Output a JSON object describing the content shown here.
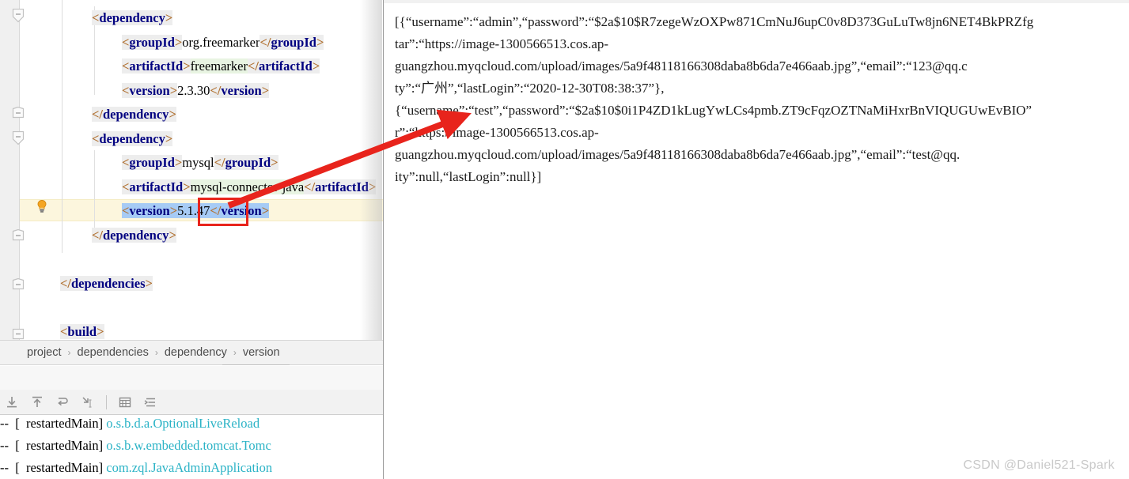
{
  "editor": {
    "lines": [
      {
        "indent": 0,
        "segments": [
          {
            "t": "tag",
            "v": "<dependency>"
          }
        ]
      },
      {
        "indent": 1,
        "segments": [
          {
            "t": "tag",
            "v": "<groupId>"
          },
          {
            "t": "txt",
            "v": "org.freemarker"
          },
          {
            "t": "tag",
            "v": "</groupId>"
          }
        ]
      },
      {
        "indent": 1,
        "segments": [
          {
            "t": "tag",
            "v": "<artifactId>"
          },
          {
            "t": "val",
            "v": "freemarker"
          },
          {
            "t": "tag",
            "v": "</artifactId>"
          }
        ]
      },
      {
        "indent": 1,
        "segments": [
          {
            "t": "tag",
            "v": "<version>"
          },
          {
            "t": "txt",
            "v": "2.3.30"
          },
          {
            "t": "tag",
            "v": "</version>"
          }
        ]
      },
      {
        "indent": 0,
        "segments": [
          {
            "t": "tag",
            "v": "</dependency>"
          }
        ]
      },
      {
        "indent": 0,
        "segments": [
          {
            "t": "tag",
            "v": "<dependency>"
          }
        ]
      },
      {
        "indent": 1,
        "segments": [
          {
            "t": "tag",
            "v": "<groupId>"
          },
          {
            "t": "txt",
            "v": "mysql"
          },
          {
            "t": "tag",
            "v": "</groupId>"
          }
        ]
      },
      {
        "indent": 1,
        "segments": [
          {
            "t": "tag",
            "v": "<artifactId>"
          },
          {
            "t": "val",
            "v": "mysql-connector-java"
          },
          {
            "t": "tag",
            "v": "</artifactId>"
          }
        ]
      },
      {
        "indent": 1,
        "segments": [
          {
            "t": "sel-tag",
            "v": "<version>"
          },
          {
            "t": "sel-txt",
            "v": "5.1.47"
          },
          {
            "t": "sel-tag",
            "v": "</version>"
          }
        ]
      },
      {
        "indent": 0,
        "segments": [
          {
            "t": "tag",
            "v": "</dependency>"
          }
        ]
      },
      {
        "indent": 0,
        "segments": []
      },
      {
        "indent": -1,
        "segments": [
          {
            "t": "tag",
            "v": "</dependencies>"
          }
        ]
      },
      {
        "indent": -1,
        "segments": []
      },
      {
        "indent": -1,
        "segments": [
          {
            "t": "tag",
            "v": "<build>"
          }
        ]
      }
    ],
    "highlighted_value": "5.1.47",
    "selected_line_text": "<version>5.1.47</version>",
    "language": "xml"
  },
  "breadcrumb": {
    "items": [
      "project",
      "dependencies",
      "dependency",
      "version"
    ],
    "separator": "›"
  },
  "console_toolbar": {
    "buttons": [
      {
        "name": "scroll-to-end",
        "glyph": "⤓"
      },
      {
        "name": "scroll-to-top",
        "glyph": "↑"
      },
      {
        "name": "soft-wrap",
        "glyph": "⤶"
      },
      {
        "name": "jump-to-source",
        "glyph": "⤷"
      },
      {
        "name": "print",
        "glyph": "▦"
      },
      {
        "name": "settings-lines",
        "glyph": "≡"
      }
    ]
  },
  "console": {
    "lines": [
      {
        "dash": "--",
        "bracket_open": "[",
        "thread": "restartedMain]",
        "cls": "o.s.b.d.a.OptionalLiveReload"
      },
      {
        "dash": "--",
        "bracket_open": "[",
        "thread": "restartedMain]",
        "cls": "o.s.b.w.embedded.tomcat.Tomc"
      },
      {
        "dash": "--",
        "bracket_open": "[",
        "thread": "restartedMain]",
        "cls": "com.zql.JavaAdminApplication"
      }
    ]
  },
  "browser": {
    "json_lines": [
      "[{“username”:“admin”,“password”:“$2a$10$R7zegeWzOXPw871CmNuJ6upC0v8D373GuLuTw8jn6NET4BkPRZfg",
      "tar”:“https://image-1300566513.cos.ap-",
      "guangzhou.myqcloud.com/upload/images/5a9f48118166308daba8b6da7e466aab.jpg”,“email”:“123@qq.c",
      "ty”:“广州”,“lastLogin”:“2020-12-30T08:38:37”},",
      "{“username”:“test”,“password”:“$2a$10$0i1P4ZD1kLugYwLCs4pmb.ZT9cFqzOZTNaMiHxrBnVIQUGUwEvBIO”",
      "r”:“https://image-1300566513.cos.ap-",
      "guangzhou.myqcloud.com/upload/images/5a9f48118166308daba8b6da7e466aab.jpg”,“email”:“test@qq.",
      "ity”:null,“lastLogin”:null}]"
    ]
  },
  "annotations": {
    "red_rect_target": "5.1.47",
    "arrow_color": "#e8241c",
    "arrow_from": "version value 5.1.47",
    "arrow_to": "https in avatar url of second record"
  },
  "watermark": {
    "text": "CSDN @Daniel521-Spark"
  },
  "colors": {
    "tag": "#000080",
    "angle": "#b07030",
    "selection": "#a6cbf5",
    "caret_line": "#fcf6dd",
    "value_bg": "#e8f4e2",
    "tag_bg": "#ededed",
    "console_class": "#2bb3c6",
    "annotation_red": "#e8241c",
    "watermark": "#c9c9c9"
  }
}
